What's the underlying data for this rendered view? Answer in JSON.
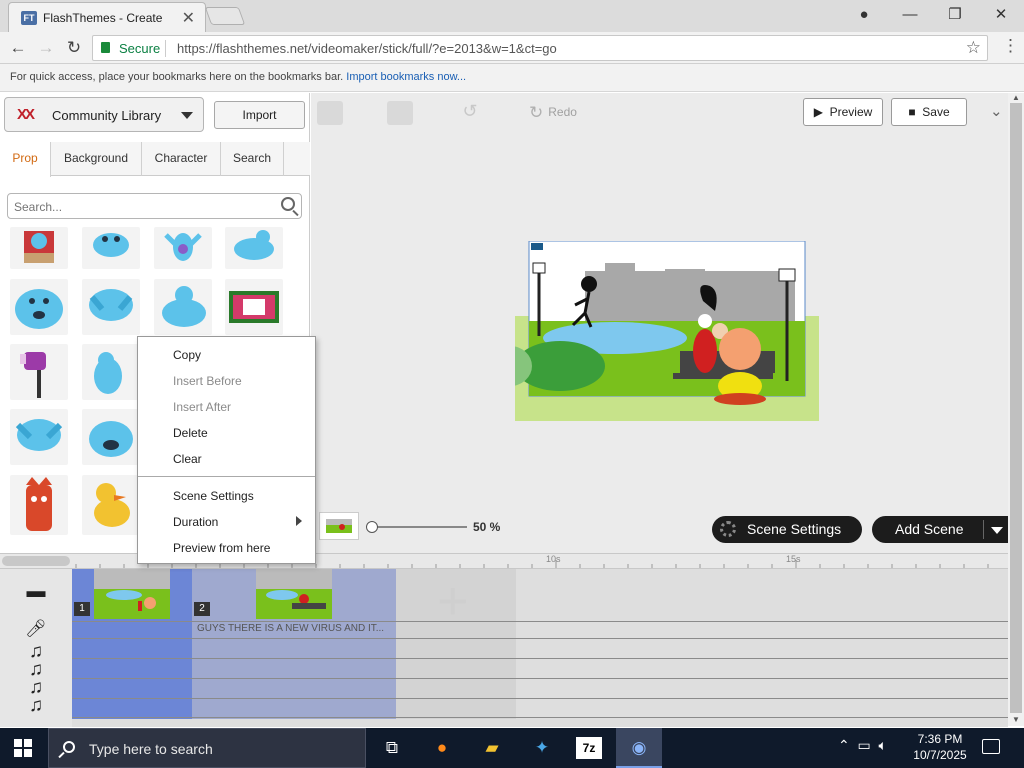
{
  "browser": {
    "tab_title": "FlashThemes - Create",
    "tab_favicon": "FT",
    "secure_label": "Secure",
    "url": "https://flashthemes.net/videomaker/stick/full/?e=2013&w=1&ct=go",
    "bookmarks_text": "For quick access, place your bookmarks here on the bookmarks bar.",
    "bookmarks_link": "Import bookmarks now..."
  },
  "library": {
    "dropdown_label": "Community Library",
    "import_label": "Import",
    "tabs": [
      "Prop",
      "Background",
      "Character",
      "Search"
    ],
    "active_tab": "Prop",
    "search_placeholder": "Search..."
  },
  "toolbar": {
    "redo_label": "Redo",
    "preview_label": "Preview",
    "save_label": "Save"
  },
  "zoom": {
    "value_label": "50 %",
    "value": 0.05
  },
  "stage_buttons": {
    "scene_settings": "Scene Settings",
    "add_scene": "Add Scene"
  },
  "context_menu": {
    "items": [
      "Copy",
      "Insert Before",
      "Insert After",
      "Delete",
      "Clear",
      "Scene Settings",
      "Duration",
      "Preview from here"
    ],
    "disabled": [
      "Insert Before",
      "Insert After"
    ]
  },
  "timeline": {
    "ruler_ticks": [
      "10s",
      "15s"
    ],
    "scenes": [
      {
        "number": "1"
      },
      {
        "number": "2"
      }
    ],
    "speech_text": "GUYS THERE IS A NEW VIRUS AND IT..."
  },
  "taskbar": {
    "search_placeholder": "Type here to search",
    "time": "7:36 PM",
    "date": "10/7/2025"
  },
  "colors": {
    "accent_orange": "#d26a13",
    "secure_green": "#0b8043",
    "timeline_selected": "#6c86d6",
    "timeline_scene": "#9fa9cf",
    "taskbar_bg": "#0f1a2b"
  }
}
